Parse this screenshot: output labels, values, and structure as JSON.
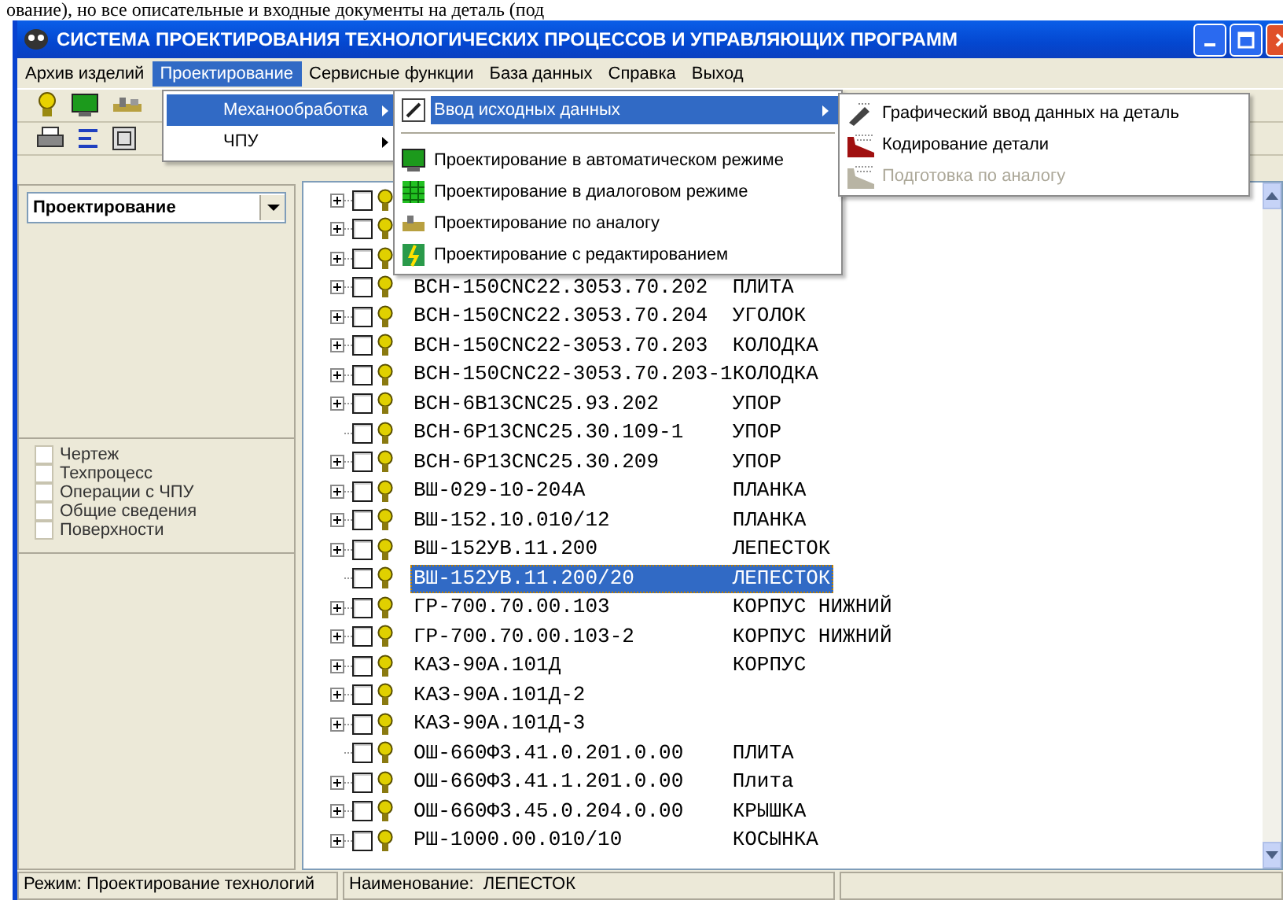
{
  "document_line": "ование), но все описательные и входные документы на деталь (под",
  "window": {
    "title": "СИСТЕМА ПРОЕКТИРОВАНИЯ ТЕХНОЛОГИЧЕСКИХ ПРОЦЕССОВ И УПРАВЛЯЮЩИХ ПРОГРАММ"
  },
  "menu_bar": [
    {
      "label": "Архив изделий",
      "selected": false
    },
    {
      "label": "Проектирование",
      "selected": true
    },
    {
      "label": "Сервисные функции",
      "selected": false
    },
    {
      "label": "База данных",
      "selected": false
    },
    {
      "label": "Справка",
      "selected": false
    },
    {
      "label": "Выход",
      "selected": false
    }
  ],
  "design_menu": [
    {
      "label": "Механообработка",
      "submenu": true,
      "selected": true
    },
    {
      "label": "ЧПУ",
      "submenu": true,
      "selected": false
    }
  ],
  "machining_menu": [
    {
      "kind": "item",
      "label": "Ввод исходных данных",
      "submenu": true,
      "selected": true
    },
    {
      "kind": "separator"
    },
    {
      "kind": "item",
      "label": "Проектирование в автоматическом режиме",
      "submenu": false,
      "selected": false
    },
    {
      "kind": "item",
      "label": "Проектирование в диалоговом режиме",
      "submenu": false,
      "selected": false
    },
    {
      "kind": "item",
      "label": "Проектирование по аналогу",
      "submenu": false,
      "selected": false
    },
    {
      "kind": "item",
      "label": "Проектирование с редактированием",
      "submenu": false,
      "selected": false
    }
  ],
  "input_menu": [
    {
      "label": "Графический ввод данных на деталь",
      "disabled": false
    },
    {
      "label": "Кодирование детали",
      "disabled": false
    },
    {
      "label": "Подготовка по аналогу",
      "disabled": true
    }
  ],
  "left_panel": {
    "combo": {
      "value": "Проектирование"
    },
    "filters": [
      {
        "label": "Чертеж",
        "checked": false
      },
      {
        "label": "Техпроцесс",
        "checked": false
      },
      {
        "label": "Операции с ЧПУ",
        "checked": false
      },
      {
        "label": "Общие сведения",
        "checked": false
      },
      {
        "label": "Поверхности",
        "checked": false
      }
    ]
  },
  "tree": [
    {
      "has_children": true,
      "checked": false
    },
    {
      "has_children": true,
      "checked": false
    },
    {
      "has_children": true,
      "checked": false
    },
    {
      "code": "ВСН-150CNC22.3053.70.202",
      "name": "ПЛИТА",
      "has_children": true,
      "checked": false,
      "selected": false
    },
    {
      "code": "ВСН-150CNC22.3053.70.204",
      "name": "УГОЛОК",
      "has_children": true,
      "checked": false,
      "selected": false
    },
    {
      "code": "ВСН-150CNC22-3053.70.203",
      "name": "КОЛОДКА",
      "has_children": true,
      "checked": false,
      "selected": false
    },
    {
      "code": "ВСН-150CNC22-3053.70.203-1",
      "name": "КОЛОДКА",
      "has_children": true,
      "checked": false,
      "selected": false
    },
    {
      "code": "ВСН-6В13CNC25.93.202",
      "name": "УПОР",
      "has_children": true,
      "checked": false,
      "selected": false
    },
    {
      "code": "ВСН-6Р13CNC25.30.109-1",
      "name": "УПОР",
      "has_children": false,
      "checked": false,
      "selected": false
    },
    {
      "code": "ВСН-6Р13CNC25.30.209",
      "name": "УПОР",
      "has_children": true,
      "checked": false,
      "selected": false
    },
    {
      "code": "ВШ-029-10-204А",
      "name": "ПЛАНКА",
      "has_children": true,
      "checked": false,
      "selected": false
    },
    {
      "code": "ВШ-152.10.010/12",
      "name": "ПЛАНКА",
      "has_children": true,
      "checked": false,
      "selected": false
    },
    {
      "code": "ВШ-152УВ.11.200",
      "name": "ЛЕПЕСТОК",
      "has_children": true,
      "checked": false,
      "selected": false
    },
    {
      "code": "ВШ-152УВ.11.200/20",
      "name": "ЛЕПЕСТОК",
      "has_children": false,
      "checked": false,
      "selected": true
    },
    {
      "code": "ГР-700.70.00.103",
      "name": "КОРПУС НИЖНИЙ",
      "has_children": true,
      "checked": false,
      "selected": false
    },
    {
      "code": "ГР-700.70.00.103-2",
      "name": "КОРПУС НИЖНИЙ",
      "has_children": true,
      "checked": false,
      "selected": false
    },
    {
      "code": "КАЗ-90А.101Д",
      "name": "КОРПУС",
      "has_children": true,
      "checked": false,
      "selected": false
    },
    {
      "code": "КАЗ-90А.101Д-2",
      "has_children": true,
      "checked": false,
      "selected": false
    },
    {
      "code": "КАЗ-90А.101Д-3",
      "has_children": true,
      "checked": false,
      "selected": false
    },
    {
      "code": "ОШ-660Ф3.41.0.201.0.00",
      "name": "ПЛИТА",
      "has_children": false,
      "checked": false,
      "selected": false
    },
    {
      "code": "ОШ-660Ф3.41.1.201.0.00",
      "name": "Плита",
      "has_children": true,
      "checked": false,
      "selected": false
    },
    {
      "code": "ОШ-660Ф3.45.0.204.0.00",
      "name": "КРЫШКА",
      "has_children": true,
      "checked": false,
      "selected": false
    },
    {
      "code": "РШ-1000.00.010/10",
      "name": "КОСЫНКА",
      "has_children": true,
      "checked": false,
      "selected": false
    }
  ],
  "status_bar": [
    "Режим: Проектирование технологий",
    "Наименование:  ЛЕПЕСТОК"
  ]
}
